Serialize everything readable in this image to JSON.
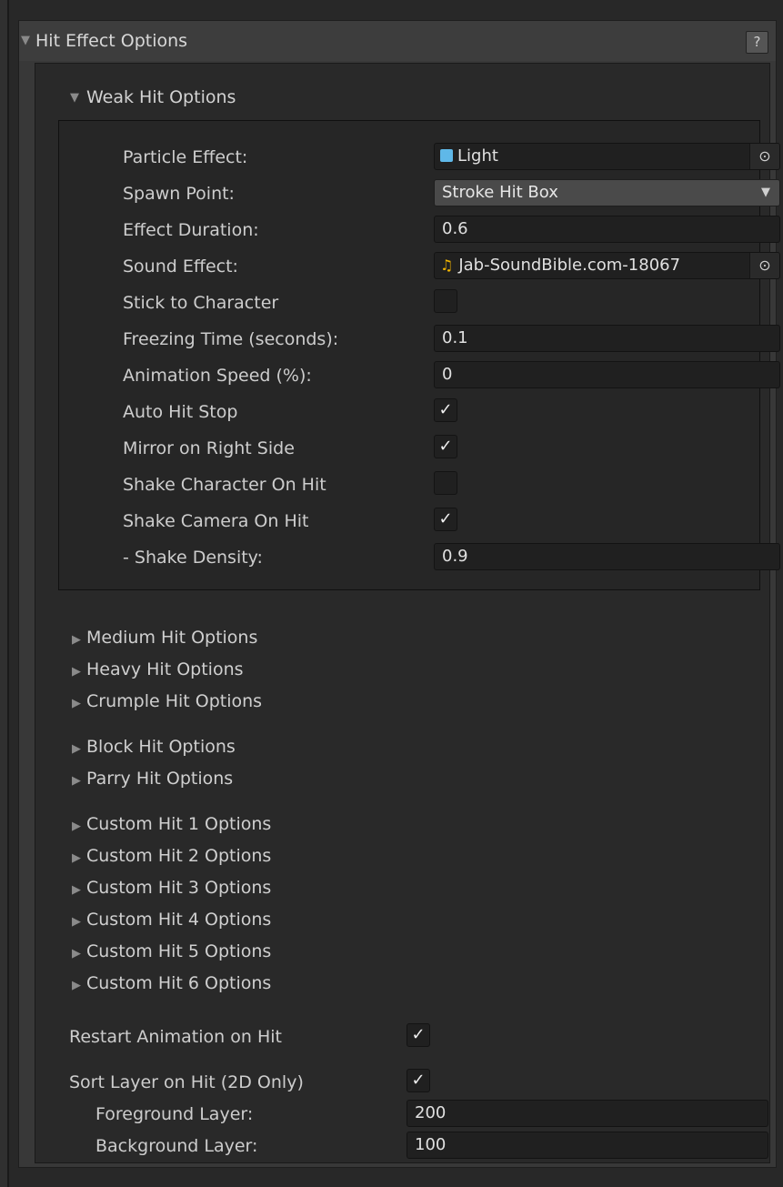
{
  "header": {
    "title": "Hit Effect Options",
    "help_label": "?"
  },
  "weak": {
    "title": "Weak Hit Options",
    "particle_effect": {
      "label": "Particle Effect:",
      "value": "Light",
      "icon": "prefab-cube-icon"
    },
    "spawn_point": {
      "label": "Spawn Point:",
      "value": "Stroke Hit Box"
    },
    "effect_duration": {
      "label": "Effect Duration:",
      "value": "0.6"
    },
    "sound_effect": {
      "label": "Sound Effect:",
      "value": "Jab-SoundBible.com-18067",
      "icon": "audio-clip-icon"
    },
    "stick_to_character": {
      "label": "Stick to Character",
      "checked": false
    },
    "freezing_time": {
      "label": "Freezing Time (seconds):",
      "value": "0.1"
    },
    "animation_speed": {
      "label": "Animation Speed (%):",
      "value": "0"
    },
    "auto_hit_stop": {
      "label": "Auto Hit Stop",
      "checked": true
    },
    "mirror_right": {
      "label": "Mirror on Right Side",
      "checked": true
    },
    "shake_character": {
      "label": "Shake Character On Hit",
      "checked": false
    },
    "shake_camera": {
      "label": "Shake Camera On Hit",
      "checked": true
    },
    "shake_density": {
      "label": "- Shake Density:",
      "value": "0.9"
    }
  },
  "foldouts": {
    "medium": "Medium Hit Options",
    "heavy": "Heavy Hit Options",
    "crumple": "Crumple Hit Options",
    "block": "Block Hit Options",
    "parry": "Parry Hit Options",
    "custom1": "Custom Hit 1 Options",
    "custom2": "Custom Hit 2 Options",
    "custom3": "Custom Hit 3 Options",
    "custom4": "Custom Hit 4 Options",
    "custom5": "Custom Hit 5 Options",
    "custom6": "Custom Hit 6 Options"
  },
  "restart_animation": {
    "label": "Restart Animation on Hit",
    "checked": true
  },
  "sort_layer": {
    "label": "Sort Layer on Hit (2D Only)",
    "checked": true
  },
  "foreground_layer": {
    "label": "Foreground Layer:",
    "value": "200"
  },
  "background_layer": {
    "label": "Background Layer:",
    "value": "100"
  },
  "glyphs": {
    "expanded": "▼",
    "collapsed": "▶",
    "check": "✓",
    "picker": "⊙",
    "dropdown": "▼",
    "note": "♫"
  },
  "colors": {
    "panel": "#383838",
    "body": "#292929",
    "field": "#202020",
    "dropdown": "#4a4a4a",
    "audio_icon": "#f0b400",
    "prefab_icon": "#5fb8e8"
  }
}
